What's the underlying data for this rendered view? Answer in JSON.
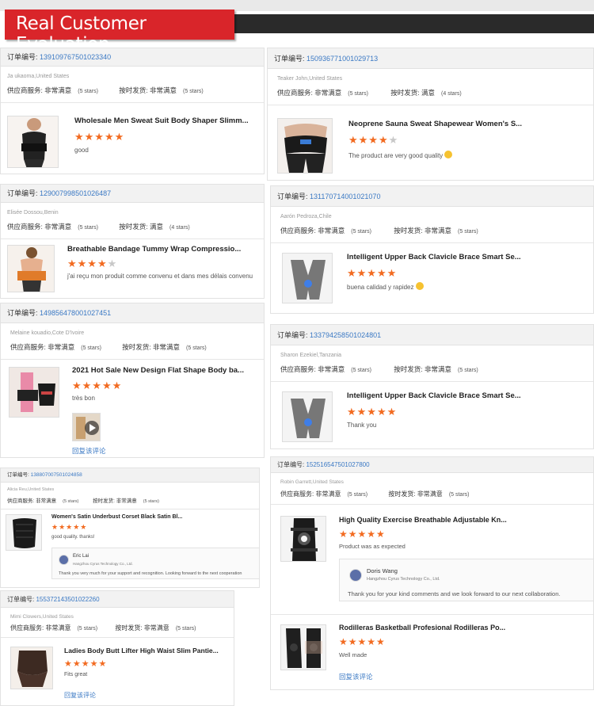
{
  "banner": {
    "title": "Real Customer Evaluation"
  },
  "labels": {
    "order": "订单编号: ",
    "supplier": "供应商服务: ",
    "delivery": "按时发货: ",
    "very_satisfied": "非常满意",
    "satisfied": "满意",
    "five_stars": "(5 stars)",
    "four_stars": "(4 stars)",
    "reply_link": "回复该评论"
  },
  "colors": {
    "accent_red": "#d9252a",
    "star": "#f26b21",
    "link": "#3b79c4"
  },
  "reviews": [
    {
      "order_no": "139109767501023340",
      "buyer": "Ja ukaoma,United States",
      "supplier_rating": "非常满意",
      "supplier_stars": "(5 stars)",
      "delivery_rating": "非常满意",
      "delivery_stars": "(5 stars)",
      "product": "Wholesale Men Sweat Suit Body Shaper Slimm...",
      "rating": 5,
      "comment": "good"
    },
    {
      "order_no": "150936771001029713",
      "buyer": "Teaker John,United States",
      "supplier_rating": "非常满意",
      "supplier_stars": "(5 stars)",
      "delivery_rating": "满意",
      "delivery_stars": "(4 stars)",
      "product": "Neoprene Sauna Sweat Shapewear Women's S...",
      "rating": 4,
      "comment": "The product are very good quality"
    },
    {
      "order_no": "129007998501026487",
      "buyer": "Elisée Dossou,Benin",
      "supplier_rating": "非常满意",
      "supplier_stars": "(5 stars)",
      "delivery_rating": "满意",
      "delivery_stars": "(4 stars)",
      "product": "Breathable Bandage Tummy Wrap Compressio...",
      "rating": 4,
      "comment": "j'ai reçu mon produit comme convenu et dans mes délais convenu"
    },
    {
      "order_no": "131170714001021070",
      "buyer": "Aarón Pedroza,Chile",
      "supplier_rating": "非常满意",
      "supplier_stars": "(5 stars)",
      "delivery_rating": "非常满意",
      "delivery_stars": "(5 stars)",
      "product": "Intelligent Upper Back Clavicle Brace Smart Se...",
      "rating": 5,
      "comment": "buena calidad y rapidez"
    },
    {
      "order_no": "149856478001027451",
      "buyer": "Melaine kouadio,Cote D'Ivoire",
      "supplier_rating": "非常满意",
      "supplier_stars": "(5 stars)",
      "delivery_rating": "非常满意",
      "delivery_stars": "(5 stars)",
      "product": "2021 Hot Sale New Design Flat Shape Body ba...",
      "rating": 5,
      "comment": "très bon"
    },
    {
      "order_no": "133794258501024801",
      "buyer": "Sharon Ezekiel,Tanzania",
      "supplier_rating": "非常满意",
      "supplier_stars": "(5 stars)",
      "delivery_rating": "非常满意",
      "delivery_stars": "(5 stars)",
      "product": "Intelligent Upper Back Clavicle Brace Smart Se...",
      "rating": 5,
      "comment": "Thank you"
    },
    {
      "order_no": "138807007501024858",
      "buyer": "Alicia Reu,United States",
      "supplier_rating": "非常满意",
      "supplier_stars": "(5 stars)",
      "delivery_rating": "非常满意",
      "delivery_stars": "(5 stars)",
      "product": "Women's Satin Underbust Corset Black Satin Bl...",
      "rating": 5,
      "comment": "good quality. thanks!",
      "reply_name": "Eric Lai",
      "reply_company": "Hangzhou Cyrus Technology Co., Ltd.",
      "reply_text": "Thank you very much for your support and recognition. Looking forward to the next cooperation"
    },
    {
      "order_no": "152516547501027800",
      "buyer": "Robin Garrett,United States",
      "supplier_rating": "非常满意",
      "supplier_stars": "(5 stars)",
      "delivery_rating": "非常满意",
      "delivery_stars": "(5 stars)",
      "product": "High Quality Exercise Breathable Adjustable Kn...",
      "rating": 5,
      "comment": "Product was as expected",
      "reply_name": "Doris Wang",
      "reply_company": "Hangzhou Cyrus Technology Co., Ltd.",
      "reply_text": "Thank you for your kind comments and we look forward to our next collaboration.",
      "product2": "Rodilleras Basketball Profesional Rodilleras Po...",
      "rating2": 5,
      "comment2": "Well made"
    },
    {
      "order_no": "155372143501022260",
      "buyer": "Mimi Clowers,United States",
      "supplier_rating": "非常满意",
      "supplier_stars": "(5 stars)",
      "delivery_rating": "非常满意",
      "delivery_stars": "(5 stars)",
      "product": "Ladies Body Butt Lifter High Waist Slim Pantie...",
      "rating": 5,
      "comment": "Fits great"
    }
  ]
}
